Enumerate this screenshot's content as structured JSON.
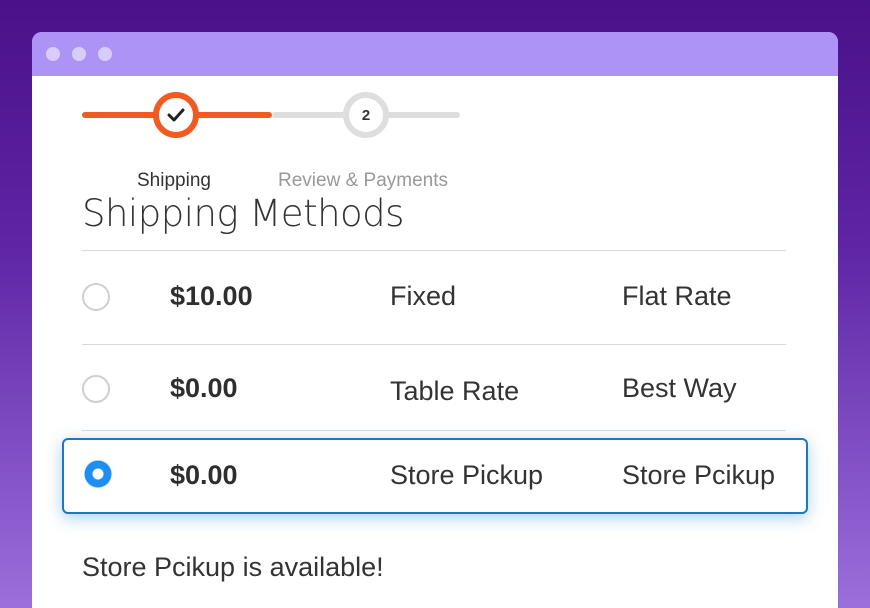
{
  "colors": {
    "accent": "#f15a22",
    "selected": "#1979c3",
    "titlebar": "#ae93f7"
  },
  "steps": [
    {
      "label": "Shipping",
      "state": "done",
      "icon": "check-icon"
    },
    {
      "label": "Review & Payments",
      "number": "2",
      "state": "upcoming"
    }
  ],
  "heading": "Shipping Methods",
  "methods": [
    {
      "price": "$10.00",
      "method": "Fixed",
      "carrier": "Flat Rate",
      "selected": false
    },
    {
      "price": "$0.00",
      "method": "Table Rate",
      "carrier": "Best Way",
      "selected": false
    },
    {
      "price": "$0.00",
      "method": "Store Pickup",
      "carrier": "Store Pcikup",
      "selected": true
    }
  ],
  "note": "Store Pcikup is available!"
}
